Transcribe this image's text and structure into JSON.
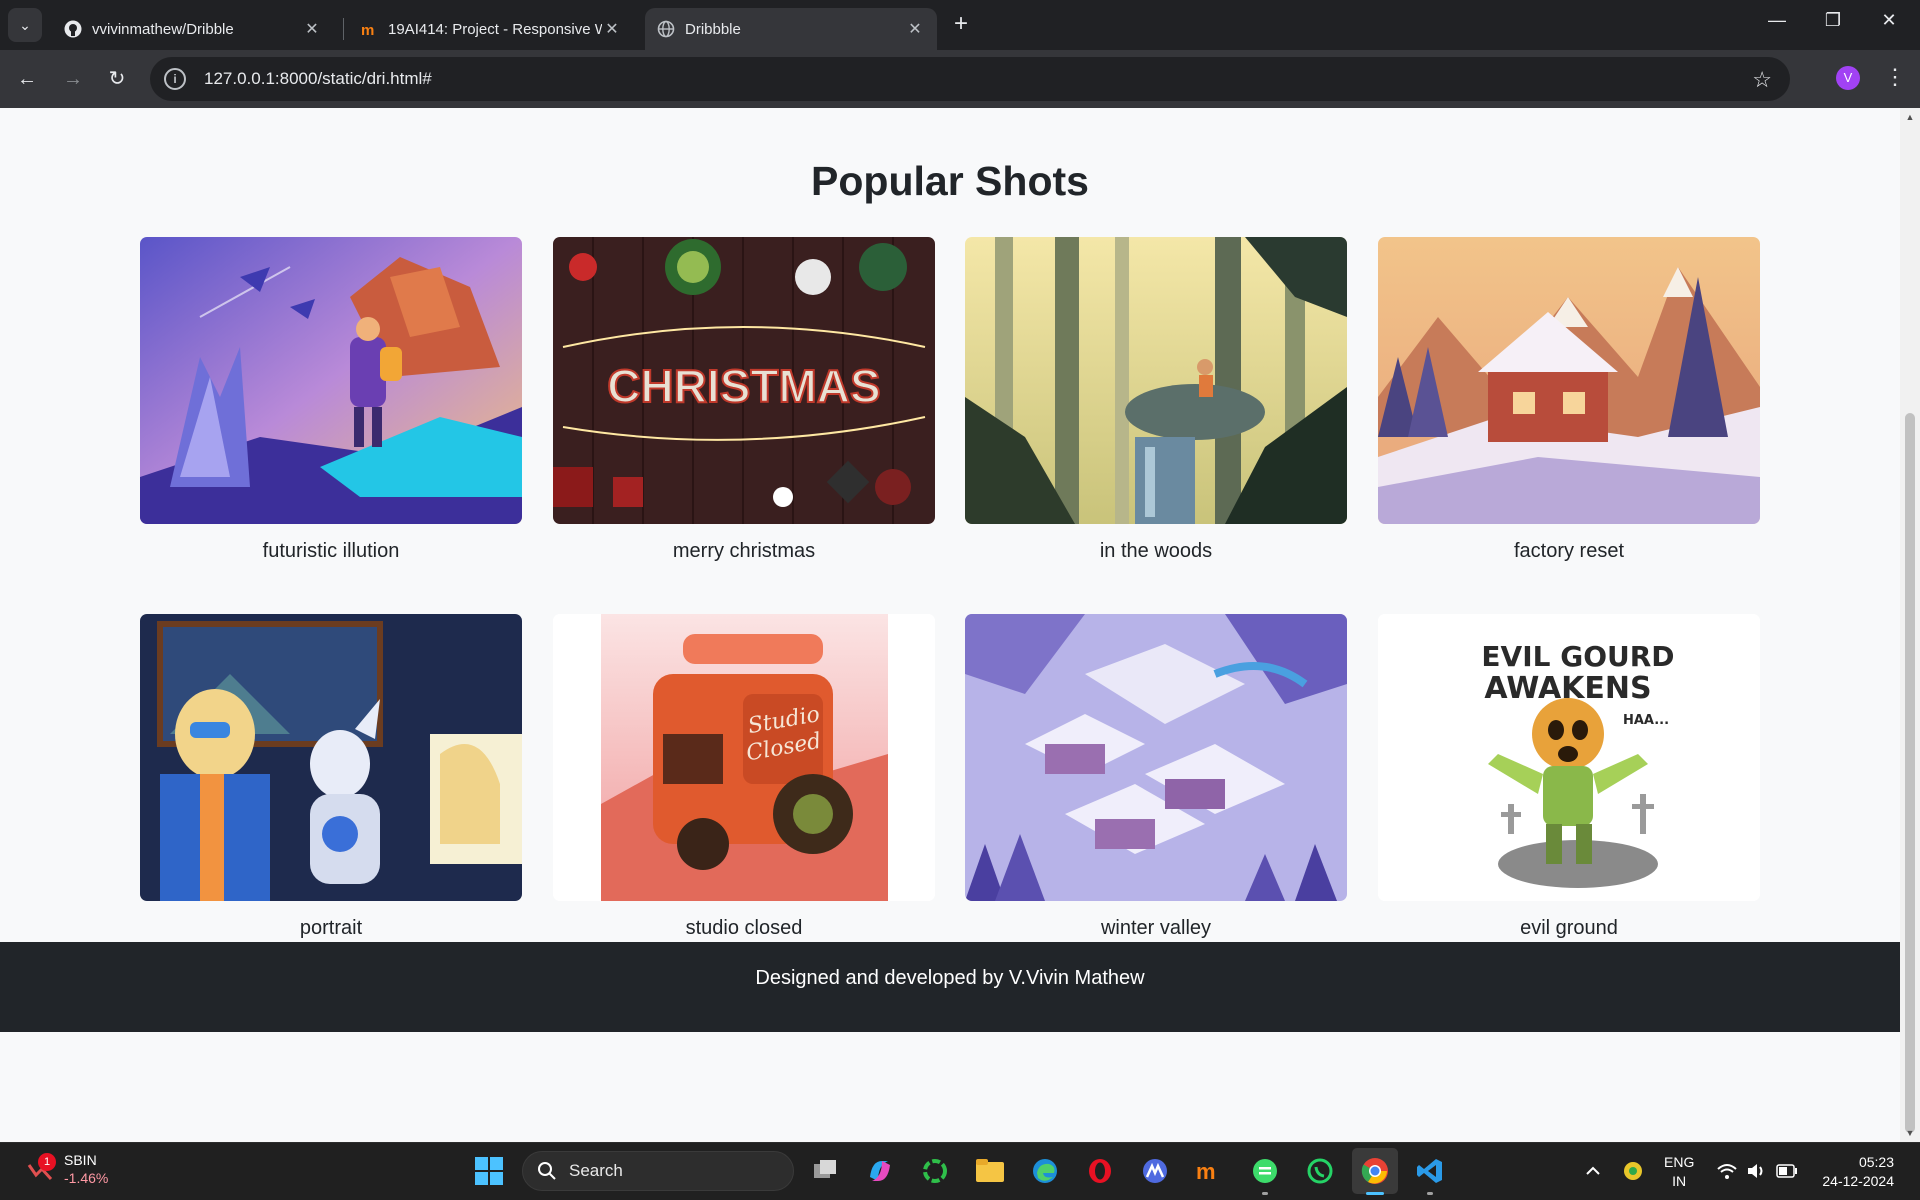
{
  "browser": {
    "tabs": [
      {
        "title": "vvivinmathew/Dribble",
        "icon": "github-icon",
        "active": false
      },
      {
        "title": "19AI414: Project - Responsive W",
        "icon": "moodle-icon",
        "active": false
      },
      {
        "title": "Dribbble",
        "icon": "globe-icon",
        "active": true
      }
    ],
    "url": "127.0.0.1:8000/static/dri.html#",
    "profile_initial": "V"
  },
  "page": {
    "title": "Popular Shots",
    "shots": [
      {
        "caption": "futuristic illution"
      },
      {
        "caption": "merry christmas"
      },
      {
        "caption": "in the woods"
      },
      {
        "caption": "factory reset"
      },
      {
        "caption": "portrait"
      },
      {
        "caption": "studio closed"
      },
      {
        "caption": "winter valley"
      },
      {
        "caption": "evil ground"
      }
    ],
    "image_text": {
      "christmas": "CHRISTMAS",
      "studio_sign_1": "Studio",
      "studio_sign_2": "Closed",
      "evil_line_1": "EVIL GOURD",
      "evil_line_2": "AWAKENS",
      "evil_line_3": "HAA..."
    },
    "footer": "Designed and developed by V.Vivin Mathew"
  },
  "taskbar": {
    "stock_name": "SBIN",
    "stock_change": "-1.46%",
    "stock_badge": "1",
    "search_label": "Search",
    "language_1": "ENG",
    "language_2": "IN",
    "time": "05:23",
    "date": "24-12-2024"
  }
}
